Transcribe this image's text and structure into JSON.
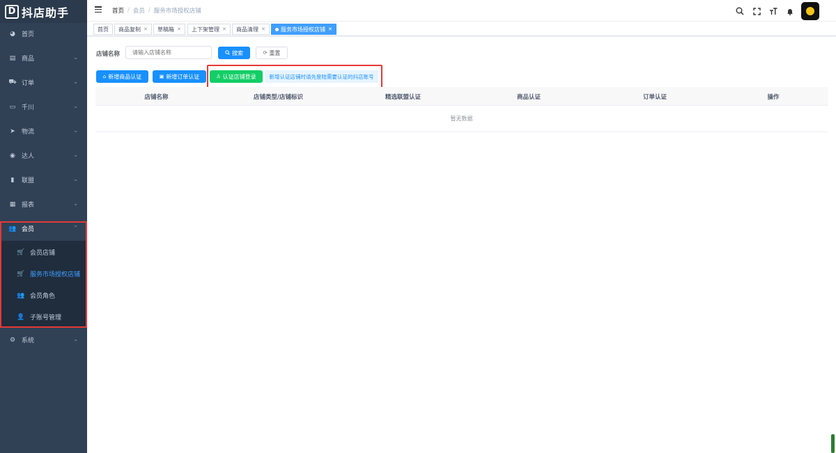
{
  "app": {
    "logo_mark": "D",
    "logo_text": "抖店助手"
  },
  "sidebar": {
    "items": [
      {
        "label": "首页",
        "icon": "dashboard-icon",
        "glyph": "◕",
        "arrow": ""
      },
      {
        "label": "商品",
        "icon": "goods-icon",
        "glyph": "▤",
        "arrow": "⌄"
      },
      {
        "label": "订单",
        "icon": "cart-icon",
        "glyph": "⛟",
        "arrow": "⌄"
      },
      {
        "label": "千川",
        "icon": "monitor-icon",
        "glyph": "▭",
        "arrow": "⌄"
      },
      {
        "label": "物流",
        "icon": "send-icon",
        "glyph": "➤",
        "arrow": "⌄"
      },
      {
        "label": "达人",
        "icon": "globe-icon",
        "glyph": "◉",
        "arrow": "⌄"
      },
      {
        "label": "联盟",
        "icon": "bar-chart-icon",
        "glyph": "▮",
        "arrow": "⌄"
      },
      {
        "label": "报表",
        "icon": "report-icon",
        "glyph": "▦",
        "arrow": "⌄"
      },
      {
        "label": "会员",
        "icon": "users-icon",
        "glyph": "👥",
        "arrow": "⌃"
      },
      {
        "label": "系统",
        "icon": "gear-icon",
        "glyph": "⚙",
        "arrow": "⌄"
      }
    ],
    "member_submenu": [
      {
        "label": "会员店铺",
        "icon": "cart-icon",
        "glyph": "🛒"
      },
      {
        "label": "服务市场授权店铺",
        "icon": "cart-icon",
        "glyph": "🛒"
      },
      {
        "label": "会员角色",
        "icon": "users-icon",
        "glyph": "👥"
      },
      {
        "label": "子账号管理",
        "icon": "user-icon",
        "glyph": "👤"
      }
    ]
  },
  "breadcrumb": [
    "首页",
    "会员",
    "服务市场授权店铺"
  ],
  "tabs": [
    {
      "label": "首页",
      "closable": false
    },
    {
      "label": "商品复制",
      "closable": true
    },
    {
      "label": "草稿箱",
      "closable": true
    },
    {
      "label": "上下架管理",
      "closable": true
    },
    {
      "label": "商品清理",
      "closable": true
    },
    {
      "label": "服务市场授权店铺",
      "closable": true,
      "active": true
    }
  ],
  "search": {
    "label": "店铺名称",
    "placeholder": "请输入店铺名称",
    "search_button": "搜索",
    "reset_button": "重置"
  },
  "actions": {
    "add_goods_auth": "新增商品认证",
    "add_order_auth": "新增订单认证",
    "auth_store_login": "认证店铺登录",
    "tip": "新增认证店铺时请先登陆需要认证的抖店账号"
  },
  "table": {
    "columns": [
      "店铺名称",
      "店铺类型/店铺标识",
      "精选联盟认证",
      "商品认证",
      "订单认证",
      "操作"
    ],
    "rows": [],
    "empty_text": "暂无数据"
  },
  "colors": {
    "sidebar_bg": "#304156",
    "primary": "#1890ff",
    "success": "#13ce66",
    "highlight": "#e53935"
  }
}
